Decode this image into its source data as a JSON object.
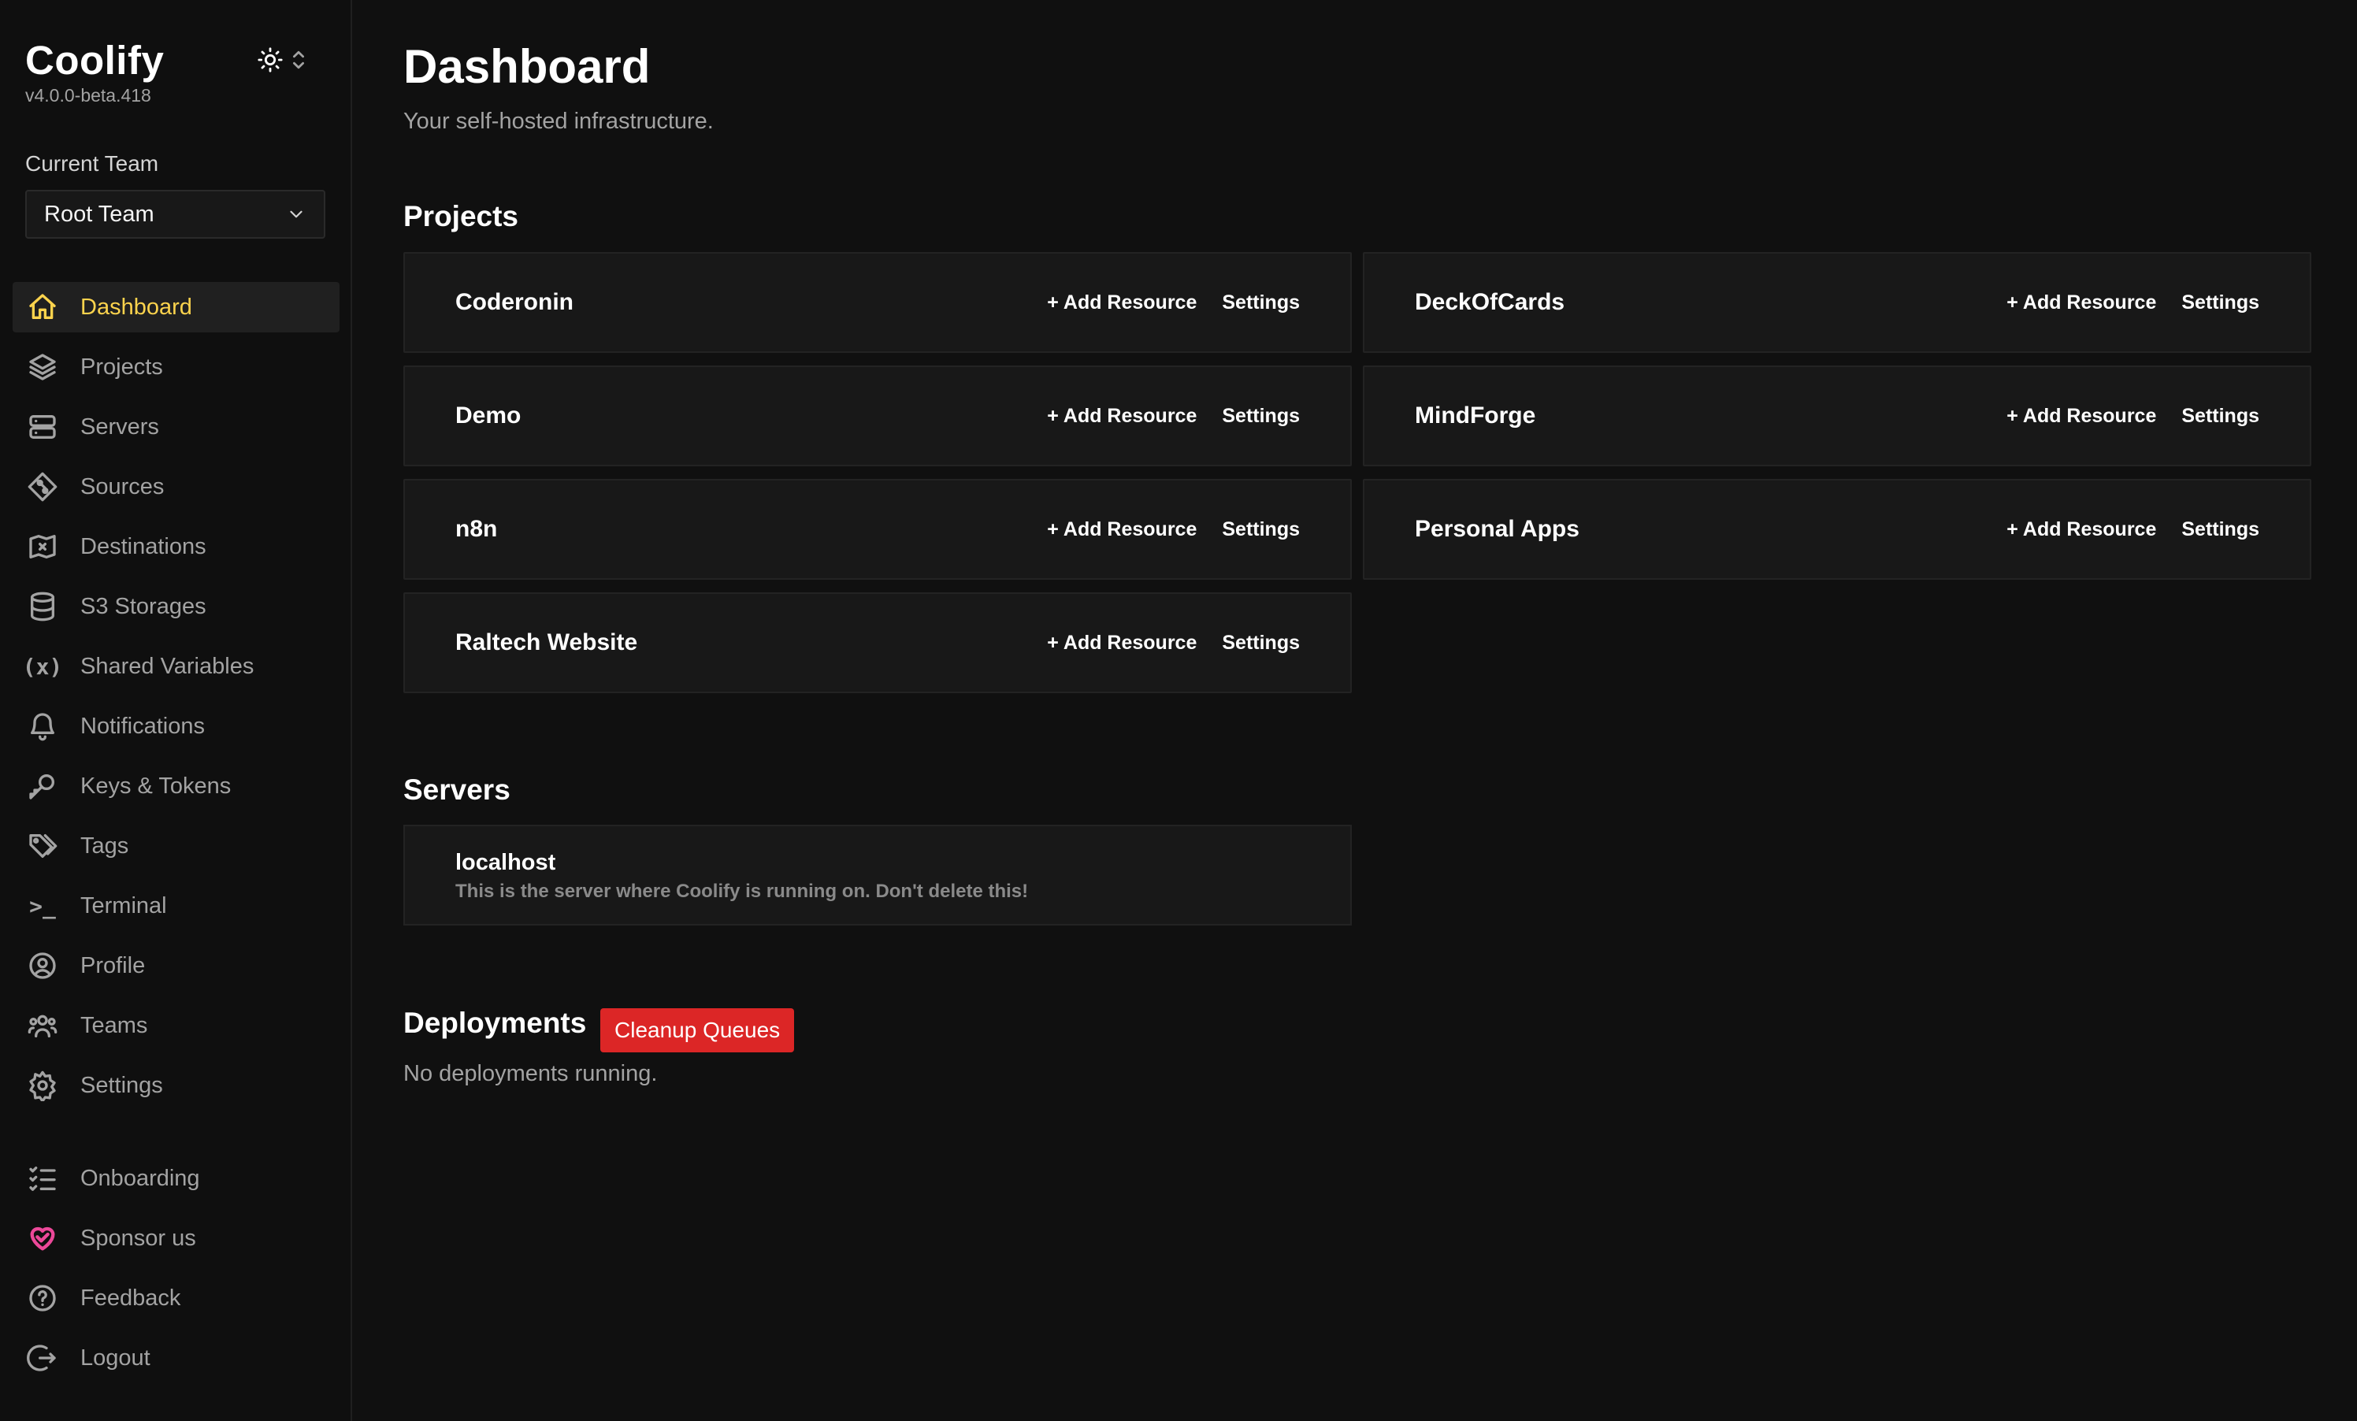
{
  "app": {
    "name": "Coolify",
    "version": "v4.0.0-beta.418"
  },
  "team": {
    "label": "Current Team",
    "selected": "Root Team"
  },
  "nav": [
    {
      "label": "Dashboard",
      "icon": "home-icon",
      "active": true
    },
    {
      "label": "Projects",
      "icon": "layers-icon"
    },
    {
      "label": "Servers",
      "icon": "server-icon"
    },
    {
      "label": "Sources",
      "icon": "git-icon"
    },
    {
      "label": "Destinations",
      "icon": "map-icon"
    },
    {
      "label": "S3 Storages",
      "icon": "database-icon"
    },
    {
      "label": "Shared Variables",
      "icon": "variable-icon",
      "glyph": "(x)"
    },
    {
      "label": "Notifications",
      "icon": "bell-icon"
    },
    {
      "label": "Keys & Tokens",
      "icon": "key-icon"
    },
    {
      "label": "Tags",
      "icon": "tags-icon"
    },
    {
      "label": "Terminal",
      "icon": "terminal-icon",
      "glyph": ">_"
    },
    {
      "label": "Profile",
      "icon": "user-circle-icon"
    },
    {
      "label": "Teams",
      "icon": "users-icon"
    },
    {
      "label": "Settings",
      "icon": "gear-icon"
    }
  ],
  "nav_bottom": [
    {
      "label": "Onboarding",
      "icon": "checklist-icon"
    },
    {
      "label": "Sponsor us",
      "icon": "heart-icon"
    },
    {
      "label": "Feedback",
      "icon": "help-icon"
    },
    {
      "label": "Logout",
      "icon": "logout-icon"
    }
  ],
  "page": {
    "title": "Dashboard",
    "subtitle": "Your self-hosted infrastructure."
  },
  "projects": {
    "title": "Projects",
    "add_label": "+ Add Resource",
    "settings_label": "Settings",
    "items": [
      "Coderonin",
      "DeckOfCards",
      "Demo",
      "MindForge",
      "n8n",
      "Personal Apps",
      "Raltech Website"
    ]
  },
  "servers": {
    "title": "Servers",
    "items": [
      {
        "name": "localhost",
        "description": "This is the server where Coolify is running on. Don't delete this!"
      }
    ]
  },
  "deployments": {
    "title": "Deployments",
    "cleanup_label": "Cleanup Queues",
    "status": "No deployments running."
  },
  "colors": {
    "accent": "#fcd34d",
    "danger": "#dc2626",
    "sponsor": "#ec4899",
    "background": "#101010",
    "card": "#181818"
  }
}
